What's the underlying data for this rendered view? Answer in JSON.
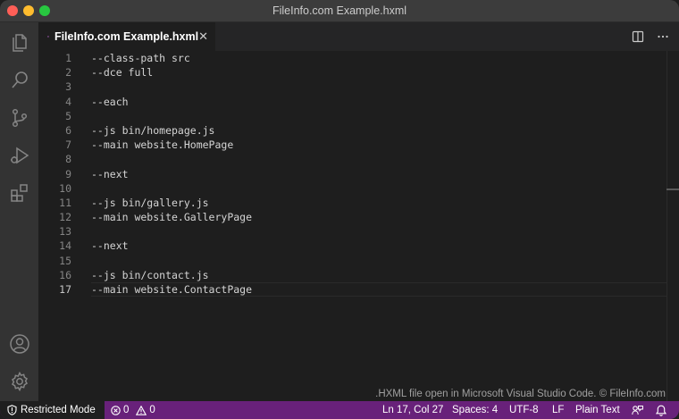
{
  "window": {
    "title": "FileInfo.com Example.hxml"
  },
  "activity_bar": {
    "icons": [
      "files-icon",
      "search-icon",
      "source-control-icon",
      "run-debug-icon",
      "extensions-icon",
      "account-icon",
      "settings-gear-icon"
    ]
  },
  "tab": {
    "label": "FileInfo.com Example.hxml",
    "close": "✕"
  },
  "editor": {
    "active_line": 17,
    "lines": [
      {
        "n": "1",
        "text": "--class-path src"
      },
      {
        "n": "2",
        "text": "--dce full"
      },
      {
        "n": "3",
        "text": ""
      },
      {
        "n": "4",
        "text": "--each"
      },
      {
        "n": "5",
        "text": ""
      },
      {
        "n": "6",
        "text": "--js bin/homepage.js"
      },
      {
        "n": "7",
        "text": "--main website.HomePage"
      },
      {
        "n": "8",
        "text": ""
      },
      {
        "n": "9",
        "text": "--next"
      },
      {
        "n": "10",
        "text": ""
      },
      {
        "n": "11",
        "text": "--js bin/gallery.js"
      },
      {
        "n": "12",
        "text": "--main website.GalleryPage"
      },
      {
        "n": "13",
        "text": ""
      },
      {
        "n": "14",
        "text": "--next"
      },
      {
        "n": "15",
        "text": ""
      },
      {
        "n": "16",
        "text": "--js bin/contact.js"
      },
      {
        "n": "17",
        "text": "--main website.ContactPage"
      }
    ]
  },
  "watermark": ".HXML file open in Microsoft Visual Studio Code. © FileInfo.com",
  "status_bar": {
    "restricted_mode": "Restricted Mode",
    "errors": "0",
    "warnings": "0",
    "position": "Ln 17, Col 27",
    "spaces": "Spaces: 4",
    "encoding": "UTF-8",
    "eol": "LF",
    "language": "Plain Text",
    "accent_color": "#68217a"
  }
}
